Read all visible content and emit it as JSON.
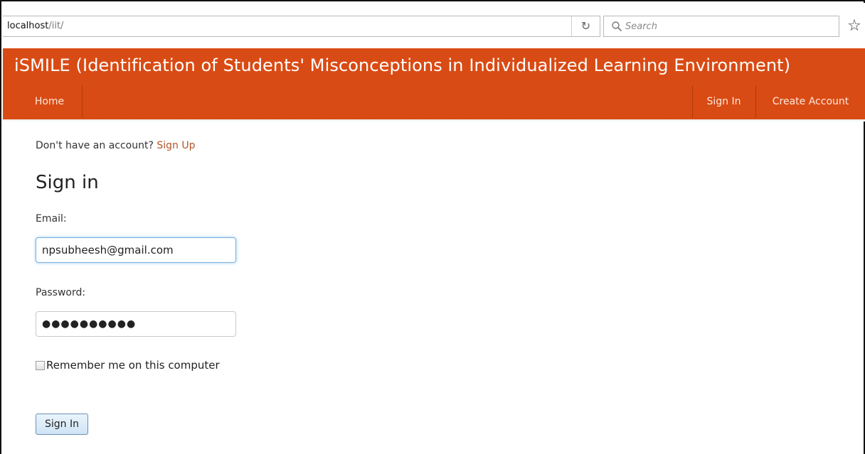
{
  "browser": {
    "url_host": "localhost",
    "url_path": "/iit/",
    "reload_icon": "reload-icon",
    "search_placeholder": "Search",
    "bookmark_icon": "star-icon"
  },
  "app": {
    "title": "iSMILE (Identification of Students' Misconceptions in Individualized Learning Environment)",
    "accent_color": "#d94b14",
    "nav": {
      "home": "Home",
      "sign_in": "Sign In",
      "create_account": "Create Account"
    }
  },
  "signin": {
    "no_account_text": "Don't have an account?",
    "sign_up_link": "Sign Up",
    "heading": "Sign in",
    "email_label": "Email:",
    "email_value": "npsubheesh@gmail.com",
    "password_label": "Password:",
    "password_masked": "●●●●●●●●●●",
    "remember_label": "Remember me on this computer",
    "remember_checked": false,
    "submit_label": "Sign In"
  }
}
